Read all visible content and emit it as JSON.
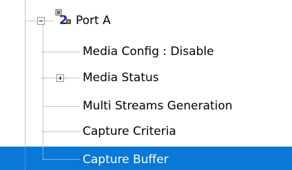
{
  "tree": {
    "port": {
      "label": "Port A",
      "expanded": true,
      "icon": "port-device-icon"
    },
    "children": [
      {
        "label": "Media Config : Disable",
        "has_children": false
      },
      {
        "label": "Media Status",
        "has_children": true,
        "expanded": false
      },
      {
        "label": "Multi Streams Generation",
        "has_children": false
      },
      {
        "label": "Capture Criteria",
        "has_children": false
      },
      {
        "label": "Capture Buffer",
        "has_children": false,
        "selected": true
      }
    ]
  },
  "colors": {
    "selection": "#0a78d7",
    "selection_text": "#ffffff",
    "tree_lines": "#8a8a8a"
  }
}
